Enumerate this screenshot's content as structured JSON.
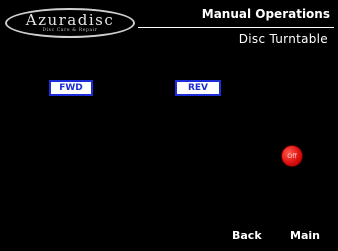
{
  "logo": {
    "name": "Azuradisc",
    "tagline": "Disc Care & Repair"
  },
  "header": {
    "title": "Manual Operations",
    "subtitle": "Disc Turntable"
  },
  "controls": {
    "fwd_label": "FWD",
    "rev_label": "REV"
  },
  "indicator": {
    "label": "Off",
    "state": "off",
    "color": "#e01010"
  },
  "nav": {
    "back_label": "Back",
    "main_label": "Main"
  },
  "colors": {
    "background": "#000000",
    "button_border": "#1c2cd8",
    "button_text": "#1c2cd8"
  }
}
